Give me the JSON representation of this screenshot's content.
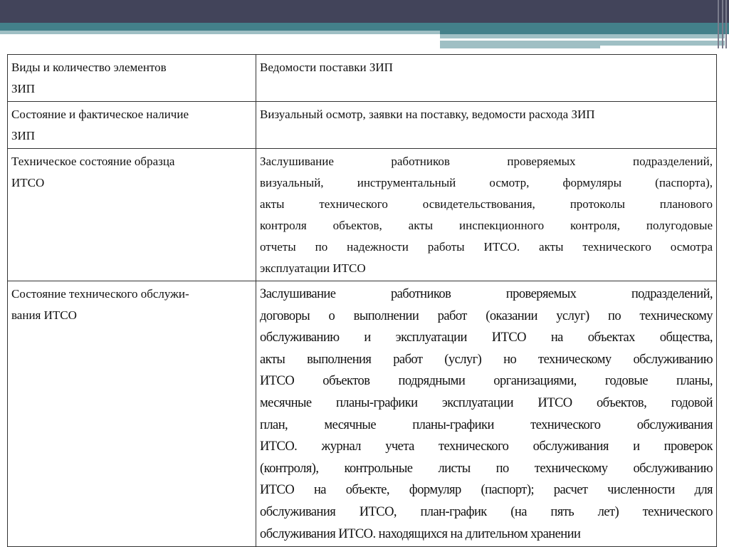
{
  "rows": [
    {
      "left": [
        "Виды и количество элементов",
        "ЗИП"
      ],
      "right": [
        "Ведомости поставки ЗИП"
      ]
    },
    {
      "left": [
        "Состояние и фактическое наличие",
        "ЗИП"
      ],
      "right": [
        "Визуальный осмотр, заявки на поставку, ведомости расхода ЗИП"
      ]
    },
    {
      "left": [
        "Техническое состояние образца",
        "ИТСО"
      ],
      "right": [
        "Заслушивание работников проверяемых подразделений,",
        "визуальный, инструментальный осмотр, формуляры (паспорта),",
        "акты технического освидетельствования, протоколы планового",
        "контроля объектов, акты инспекционного контроля, полугодовые",
        "отчеты по надежности работы ИТСО. акты технического осмотра",
        "эксплуатации ИТСО"
      ]
    },
    {
      "left": [
        "Состояние технического обслужи-",
        "вания ИТСО"
      ],
      "right": [
        "Заслушивание работников проверяемых подразделений,",
        "договоры о выполнении работ (оказании услуг) по техническому",
        "обслуживанию и эксплуатации ИТСО на объектах общества,",
        "акты выполнения работ (услуг) но техническому обслуживанию",
        "ИТСО объектов подрядными организациями, годовые планы,",
        "месячные планы-графики эксплуатации ИТСО объектов, годовой",
        "план, месячные планы-графики технического обслуживания",
        "ИТСО. журнал учета технического обслуживания и проверок",
        "(контроля), контрольные листы по техническому обслуживанию",
        "ИТСО на объекте, формуляр (паспорт); расчет численности для",
        "обслуживания ИТСО, план-график (на пять лет) технического",
        "обслуживания ИТСО. находящихся на длительном хранении"
      ]
    }
  ]
}
